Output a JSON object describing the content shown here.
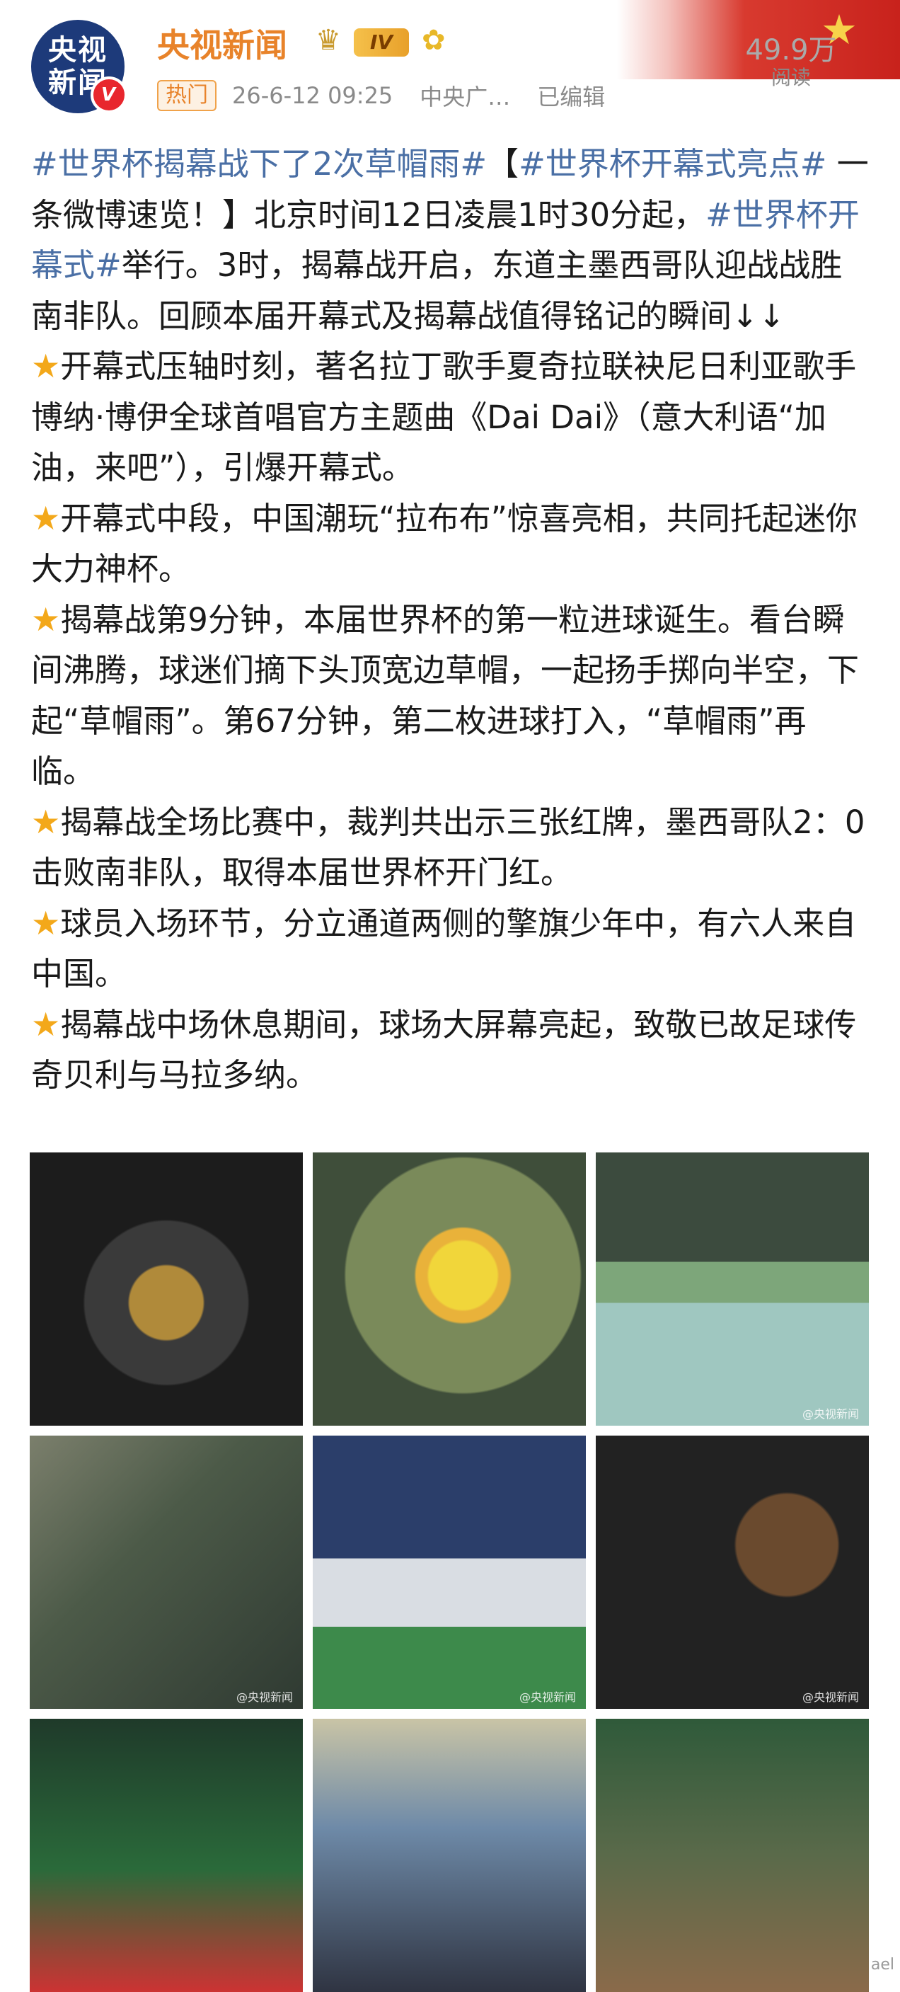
{
  "header": {
    "avatar_text_top": "央视",
    "avatar_text_bottom": "新闻",
    "avatar_badge": "V",
    "username": "央视新闻",
    "level_badge": "IV",
    "reads_count": "49.9万",
    "reads_label": "阅读",
    "hot_tag": "热门",
    "timestamp": "26-6-12 09:25",
    "source": "中央广…",
    "edited": "已编辑",
    "colors": {
      "username": "#e8832a",
      "hashtag": "#4a6fa5",
      "star": "#f3a81a"
    }
  },
  "post": {
    "intro": {
      "tag1": "#世界杯揭幕战下了2次草帽雨#",
      "bracket_open": "【",
      "tag2": "#世界杯开幕式亮点#",
      "text1": " 一条微博速览！】北京时间12日凌晨1时30分起，",
      "tag3": "#世界杯开幕式#",
      "text2": "举行。3时，揭幕战开启，东道主墨西哥队迎战战胜南非队。回顾本届开幕式及揭幕战值得铭记的瞬间↓↓"
    },
    "bullets": [
      "开幕式压轴时刻，著名拉丁歌手夏奇拉联袂尼日利亚歌手博纳·博伊全球首唱官方主题曲《Dai Dai》（意大利语“加油，来吧”），引爆开幕式。",
      "开幕式中段，中国潮玩“拉布布”惊喜亮相，共同托起迷你大力神杯。",
      "揭幕战第9分钟，本届世界杯的第一粒进球诞生。看台瞬间沸腾，球迷们摘下头顶宽边草帽，一起扬手掷向半空，下起“草帽雨”。第67分钟，第二枚进球打入，“草帽雨”再临。",
      "揭幕战全场比赛中，裁判共出示三张红牌，墨西哥队2：0击败南非队，取得本届世界杯开门红。",
      "球员入场环节，分立通道两侧的擎旗少年中，有六人来自中国。",
      "揭幕战中场休息期间，球场大屏幕亮起，致敬已故足球传奇贝利与马拉多纳。"
    ]
  },
  "images": [
    {
      "name": "image-trophy-smoke"
    },
    {
      "name": "image-singer-yellow",
      "watermark": ""
    },
    {
      "name": "image-labubu-pitch",
      "watermark": "@央视新闻"
    },
    {
      "name": "image-crowd-stands"
    },
    {
      "name": "image-flags-parade",
      "watermark": "@央视新闻"
    },
    {
      "name": "image-pele-tribute",
      "watermark": "@央视新闻"
    },
    {
      "name": "image-players-celebrate"
    },
    {
      "name": "image-maradona-trophy"
    },
    {
      "name": "image-team-huddle"
    }
  ],
  "watermarks": {
    "t2": "",
    "t3": "@央视新闻",
    "t4": "@央视新闻",
    "t5": "@央视新闻",
    "t6": "@央视新闻"
  },
  "corner_watermark": "ael"
}
